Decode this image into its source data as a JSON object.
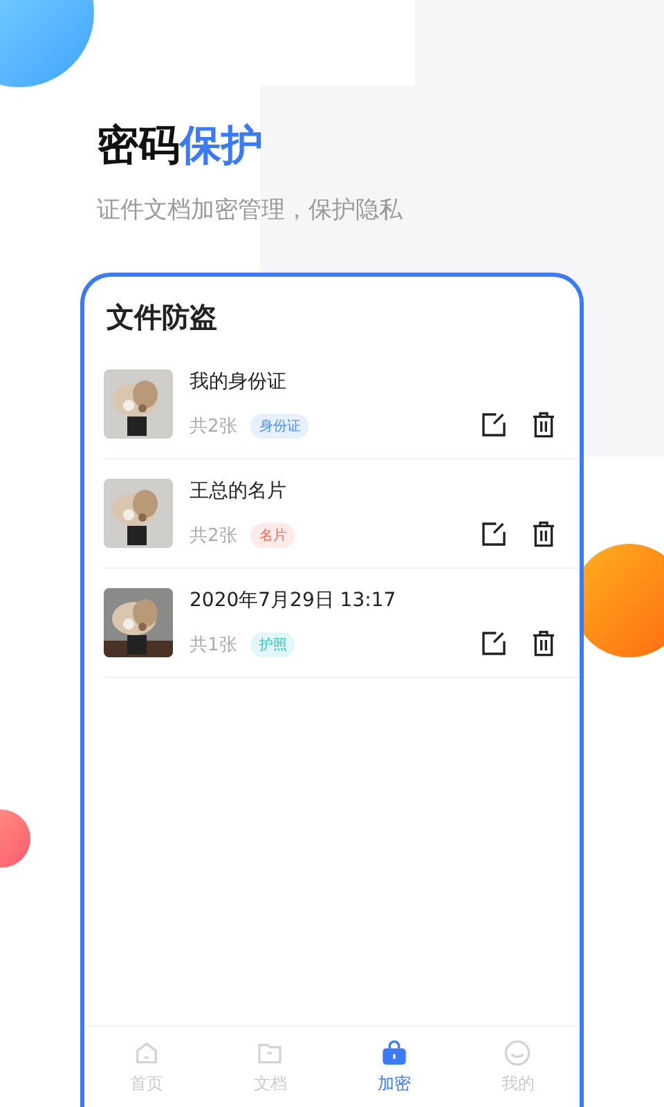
{
  "headline": {
    "plain": "密码",
    "accent": "保护"
  },
  "subtitle": "证件文档加密管理，保护隐私",
  "card": {
    "title": "文件防盗",
    "files": [
      {
        "name": "我的身份证",
        "count": "共2张",
        "tag": "身份证",
        "color": "#4a90f0"
      },
      {
        "name": "王总的名片",
        "count": "共2张",
        "tag": "名片",
        "color": "#f06a5a"
      },
      {
        "name": "2020年7月29日 13:17",
        "count": "共1张",
        "tag": "护照",
        "color": "#22c4c4"
      }
    ]
  },
  "tabs": [
    {
      "label": "首页",
      "kind": "home",
      "selected": false
    },
    {
      "label": "文档",
      "kind": "folder",
      "selected": false
    },
    {
      "label": "加密",
      "kind": "lock",
      "selected": true
    },
    {
      "label": "我的",
      "kind": "smile",
      "selected": false
    }
  ]
}
